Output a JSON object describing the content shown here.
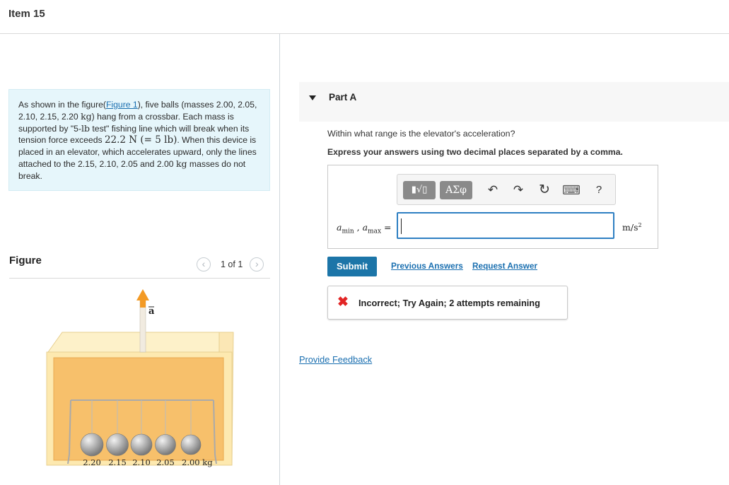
{
  "header": {
    "title": "Item 15"
  },
  "problem": {
    "t1": "As shown in the figure(",
    "figure_link": "Figure 1",
    "t2": "), five balls (masses 2.00, 2.05, 2.10, 2.15, 2.20 ",
    "unit_kg": "kg",
    "t3": ") hang from a crossbar. Each mass is supported by \"5-",
    "unit_lb": "lb",
    "t4": " test\" fishing line which will break when its tension force exceeds ",
    "tension_value": "22.2 N (= 5 lb)",
    "t5": ". When this device is placed in an elevator, which accelerates upward, only the lines attached to the 2.15, 2.10, 2.05 and 2.00 ",
    "unit_kg2": "kg",
    "t6": " masses do not break."
  },
  "figure": {
    "label": "Figure",
    "prev": "‹",
    "next": "›",
    "count": "1 of 1",
    "accel_label": "a",
    "mass_labels": [
      "2.20",
      "2.15",
      "2.10",
      "2.05",
      "2.00 kg"
    ],
    "colors": {
      "frame": "#fbe7b5",
      "frame_inner": "#fde79a",
      "back": "#f8c97a",
      "arrow": "#f39a25",
      "ball": "#9a9a9a"
    }
  },
  "part": {
    "title": "Part A",
    "question": "Within what range is the elevator's acceleration?",
    "instruction": "Express your answers using two decimal places separated by a comma.",
    "toolbar": {
      "templates": "▮√▯",
      "symbols": "ΑΣφ",
      "undo": "↶",
      "redo": "↷",
      "reset": "↻",
      "keyboard": "⌨",
      "help": "?"
    },
    "math_label": {
      "a": "a",
      "min": "min",
      "sep": " , ",
      "a2": "a",
      "max": "max",
      "eq": " ="
    },
    "input_value": "",
    "unit": "m/s",
    "unit_exp": "2",
    "submit": "Submit",
    "previous_answers": "Previous Answers",
    "request_answer": "Request Answer",
    "feedback_icon": "✖",
    "feedback": "Incorrect; Try Again; 2 attempts remaining",
    "provide_feedback": "Provide Feedback",
    "colors": {
      "accent": "#1c75a8",
      "error": "#e22525",
      "link": "#1a6fb0"
    }
  }
}
